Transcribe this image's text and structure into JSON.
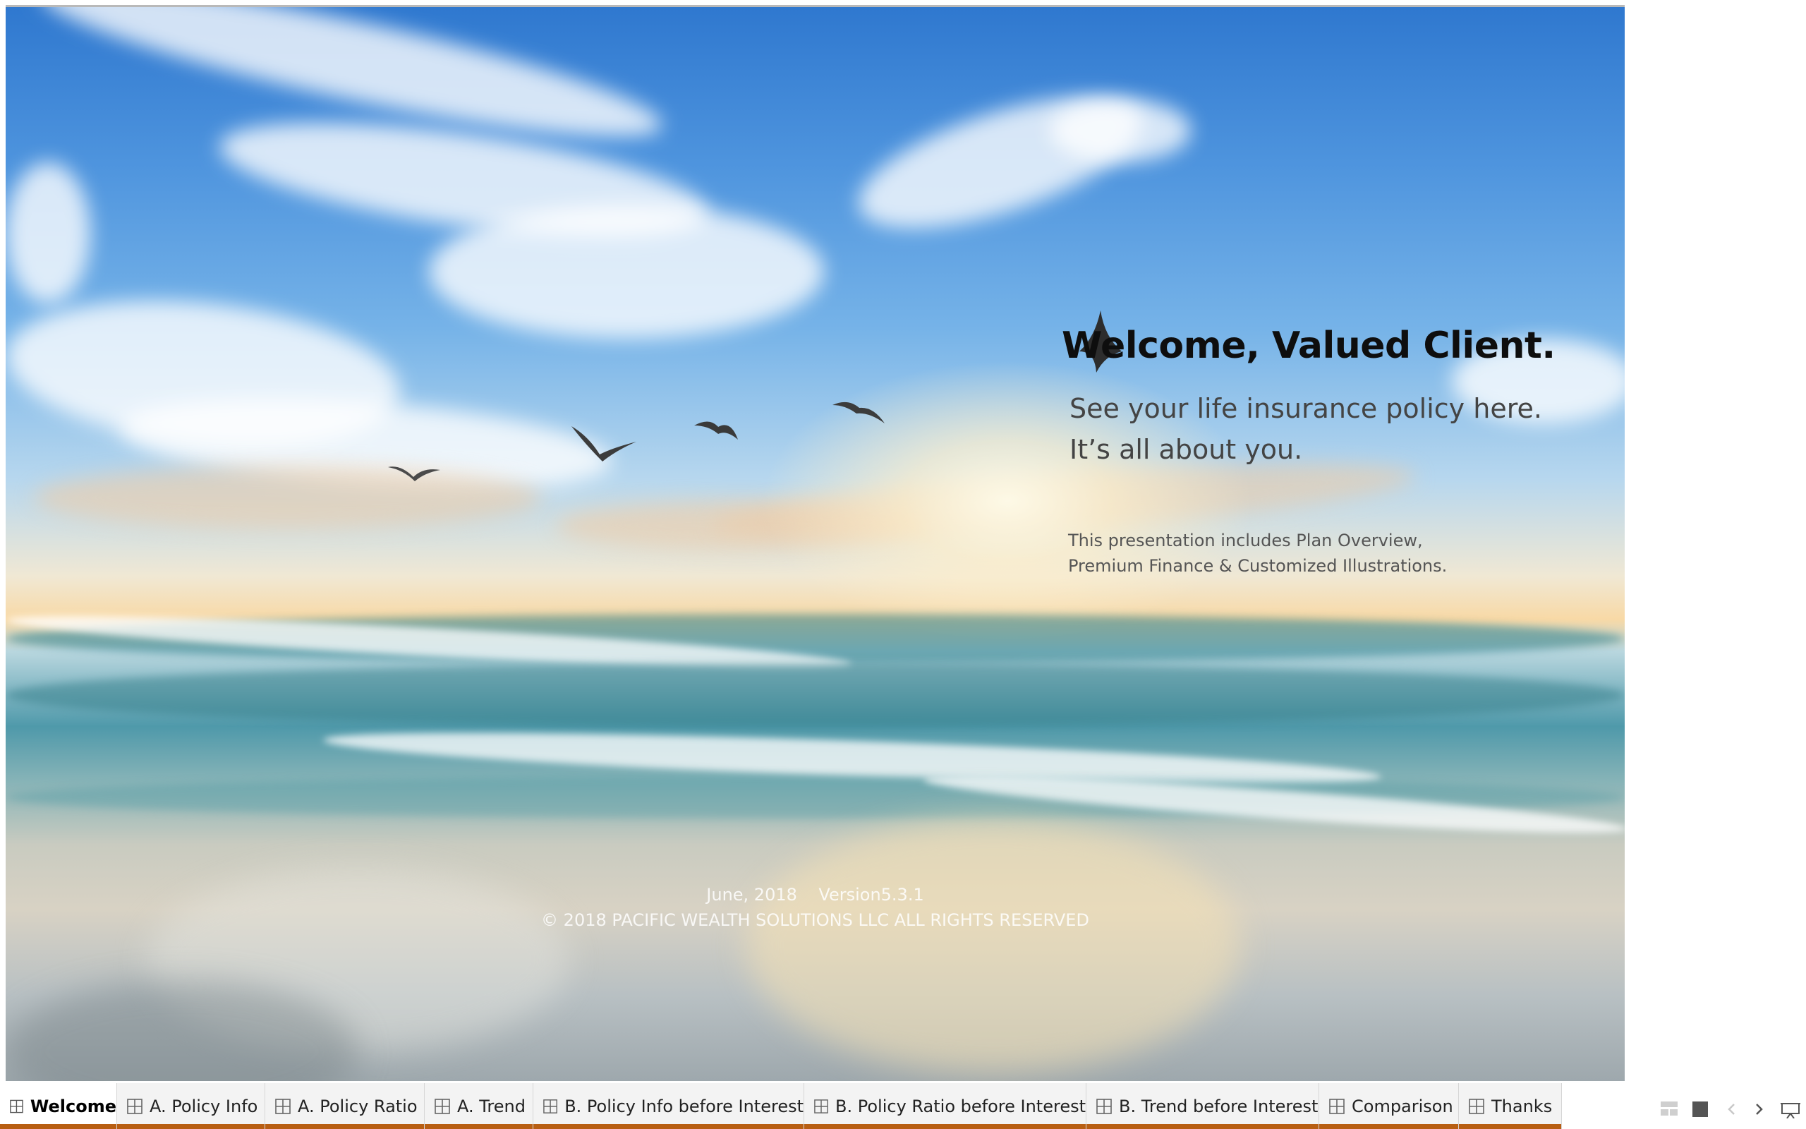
{
  "dashboard": {
    "title": "Welcome, Valued Client.",
    "subtitle_line1": "See your life insurance policy here.",
    "subtitle_line2": "It’s all about you.",
    "description_line1": "This presentation includes Plan Overview,",
    "description_line2": "Premium Finance & Customized Illustrations.",
    "footer_date_version": "June, 2018    Version5.3.1",
    "footer_copyright": "© 2018 PACIFIC WEALTH SOLUTIONS LLC ALL RIGHTS RESERVED"
  },
  "tabs": [
    {
      "label": "Welcome",
      "active": true
    },
    {
      "label": "A. Policy Info",
      "active": false
    },
    {
      "label": "A. Policy Ratio",
      "active": false
    },
    {
      "label": "A. Trend",
      "active": false
    },
    {
      "label": "B. Policy Info before Interest",
      "active": false
    },
    {
      "label": "B. Policy Ratio before Interest",
      "active": false
    },
    {
      "label": "B. Trend before Interest",
      "active": false
    },
    {
      "label": "Comparison",
      "active": false
    },
    {
      "label": "Thanks",
      "active": false
    }
  ],
  "icons": {
    "tab_icon": "sheet-grid-icon",
    "nav": [
      "filmstrip-icon",
      "single-sheet-icon",
      "previous-sheet-icon",
      "next-sheet-icon",
      "presentation-mode-icon"
    ]
  },
  "colors": {
    "tab_accent": "#b85e12",
    "title": "#0e0e0e",
    "subtitle": "#444444"
  }
}
